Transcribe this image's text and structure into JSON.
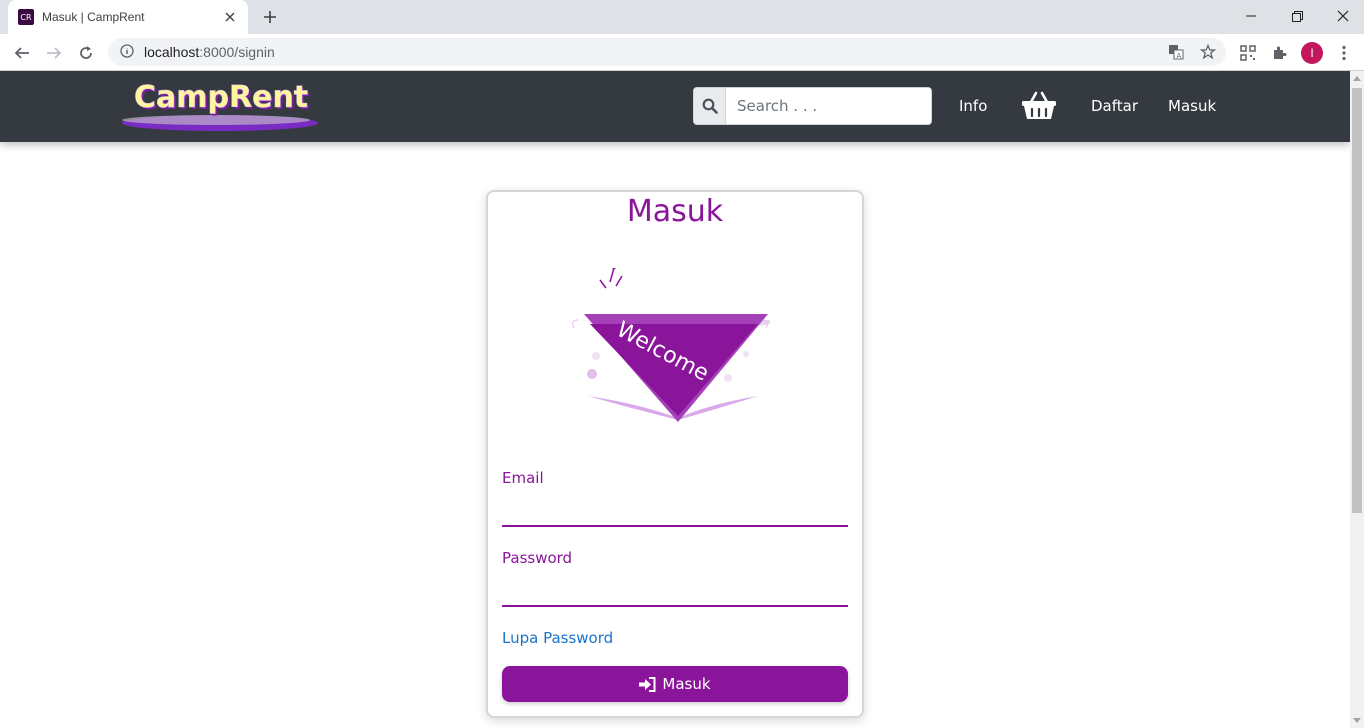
{
  "browser": {
    "tab_title": "Masuk | CampRent",
    "favicon_text": "CR",
    "url_host": "localhost",
    "url_rest": ":8000/signin",
    "profile_initial": "I",
    "profile_color": "#c2185b"
  },
  "site": {
    "brand": "CampRent",
    "search_placeholder": "Search . . .",
    "nav": {
      "info": "Info",
      "daftar": "Daftar",
      "masuk": "Masuk"
    },
    "colors": {
      "navbar": "#343a40",
      "accent": "#8a159b",
      "link": "#1a73c8"
    }
  },
  "login": {
    "title": "Masuk",
    "image_text": "Welcome",
    "email_label": "Email",
    "email_value": "",
    "password_label": "Password",
    "password_value": "",
    "forgot_label": "Lupa Password",
    "submit_label": "Masuk"
  },
  "icons": {
    "back": "arrow-left-icon",
    "forward": "arrow-right-icon",
    "reload": "reload-icon",
    "info": "info-icon",
    "translate": "translate-icon",
    "star": "star-icon",
    "qr": "qr-icon",
    "extensions": "puzzle-icon",
    "menu": "kebab-menu-icon",
    "search": "search-icon",
    "cart": "basket-icon",
    "signin": "sign-in-icon"
  }
}
